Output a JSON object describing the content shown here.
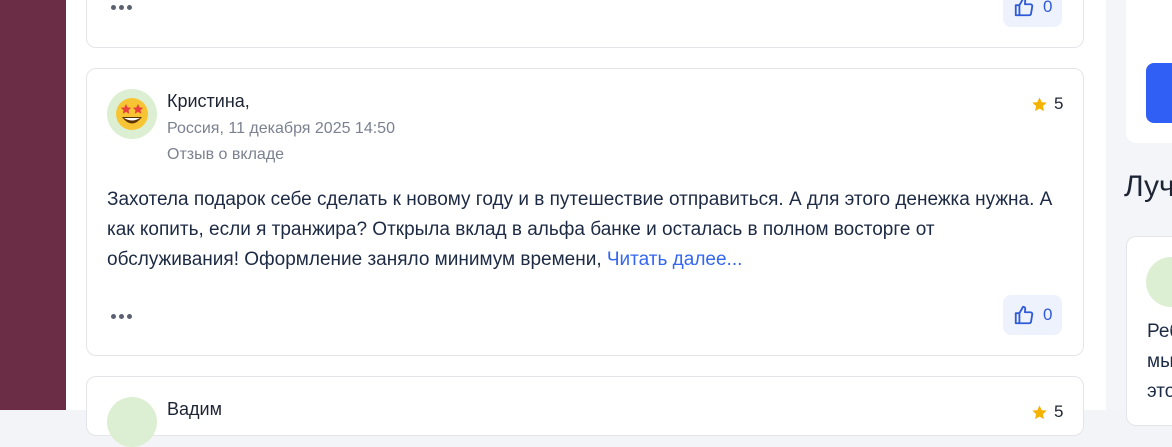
{
  "colors": {
    "accent": "#3466f0",
    "star": "#f5b301",
    "strip": "#6a2d45"
  },
  "previous_review": {
    "likes": "0"
  },
  "review": {
    "author": "Кристина,",
    "location_date": "Россия, 11 декабря 2025 14:50",
    "topic": "Отзыв о вкладе",
    "rating": "5",
    "text": "Захотела подарок себе сделать к новому году и в путешествие отправиться. А для этого денежка нужна. А как копить, если я транжира? Открыла вклад в альфа банке и осталась в полном восторге от обслуживания! Оформление заняло минимум времени, ",
    "read_more": "Читать далее...",
    "likes": "0"
  },
  "next_review": {
    "author": "Вадим",
    "rating": "5"
  },
  "sidebar": {
    "heading": "Луч",
    "text_lines": [
      "Реб",
      "мы",
      "это"
    ]
  }
}
